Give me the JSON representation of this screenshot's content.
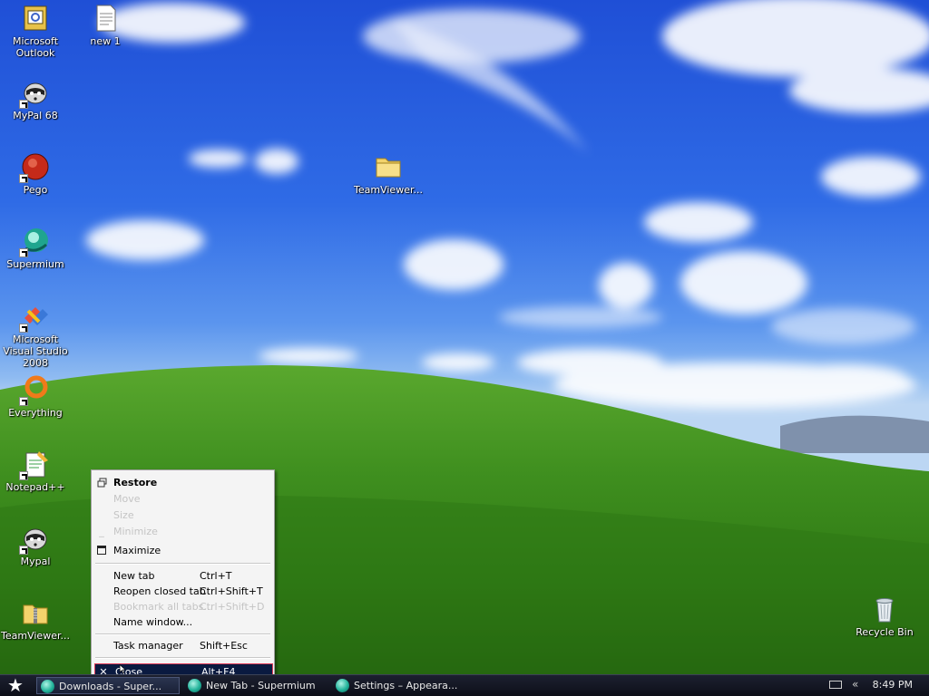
{
  "desktop": {
    "icons": [
      {
        "label": "Microsoft Outlook",
        "icon": "outlook-icon"
      },
      {
        "label": "new 1",
        "icon": "text-document-icon"
      },
      {
        "label": "MyPal 68",
        "icon": "mypal-icon"
      },
      {
        "label": "Pego",
        "icon": "pego-icon"
      },
      {
        "label": "Supermium",
        "icon": "supermium-icon"
      },
      {
        "label": "Microsoft Visual Studio 2008",
        "icon": "visual-studio-icon"
      },
      {
        "label": "Everything",
        "icon": "everything-icon"
      },
      {
        "label": "Notepad++",
        "icon": "notepadpp-icon"
      },
      {
        "label": "Mypal",
        "icon": "mypal-icon"
      },
      {
        "label": "TeamViewer...",
        "icon": "zip-folder-icon"
      },
      {
        "label": "TeamViewer...",
        "icon": "folder-icon"
      },
      {
        "label": "Recycle Bin",
        "icon": "recycle-bin-icon"
      }
    ]
  },
  "context_menu": {
    "items": [
      {
        "label": "Restore",
        "shortcut": "",
        "disabled": false,
        "bold": true,
        "glyph": "restore-icon"
      },
      {
        "label": "Move",
        "shortcut": "",
        "disabled": true
      },
      {
        "label": "Size",
        "shortcut": "",
        "disabled": true
      },
      {
        "label": "Minimize",
        "shortcut": "",
        "disabled": true,
        "glyph": "minimize-icon"
      },
      {
        "label": "Maximize",
        "shortcut": "",
        "disabled": false,
        "glyph": "maximize-icon"
      },
      {
        "label": "New tab",
        "shortcut": "Ctrl+T",
        "disabled": false
      },
      {
        "label": "Reopen closed tab",
        "shortcut": "Ctrl+Shift+T",
        "disabled": false
      },
      {
        "label": "Bookmark all tabs...",
        "shortcut": "Ctrl+Shift+D",
        "disabled": true
      },
      {
        "label": "Name window...",
        "shortcut": "",
        "disabled": false
      },
      {
        "label": "Task manager",
        "shortcut": "Shift+Esc",
        "disabled": false
      },
      {
        "label": "Close",
        "shortcut": "Alt+F4",
        "disabled": false,
        "highlighted": true,
        "glyph": "close-icon"
      }
    ]
  },
  "taskbar": {
    "start_icon": "start-star-icon",
    "tasks": [
      {
        "label": "Downloads - Super...",
        "icon": "supermium-icon",
        "active": true
      },
      {
        "label": "New Tab - Supermium",
        "icon": "supermium-icon",
        "active": false
      },
      {
        "label": "Settings – Appeara...",
        "icon": "supermium-icon",
        "active": false
      }
    ],
    "tray": {
      "keyboard_icon": "keyboard-icon",
      "chevron": "«",
      "clock": "8:49 PM"
    }
  }
}
